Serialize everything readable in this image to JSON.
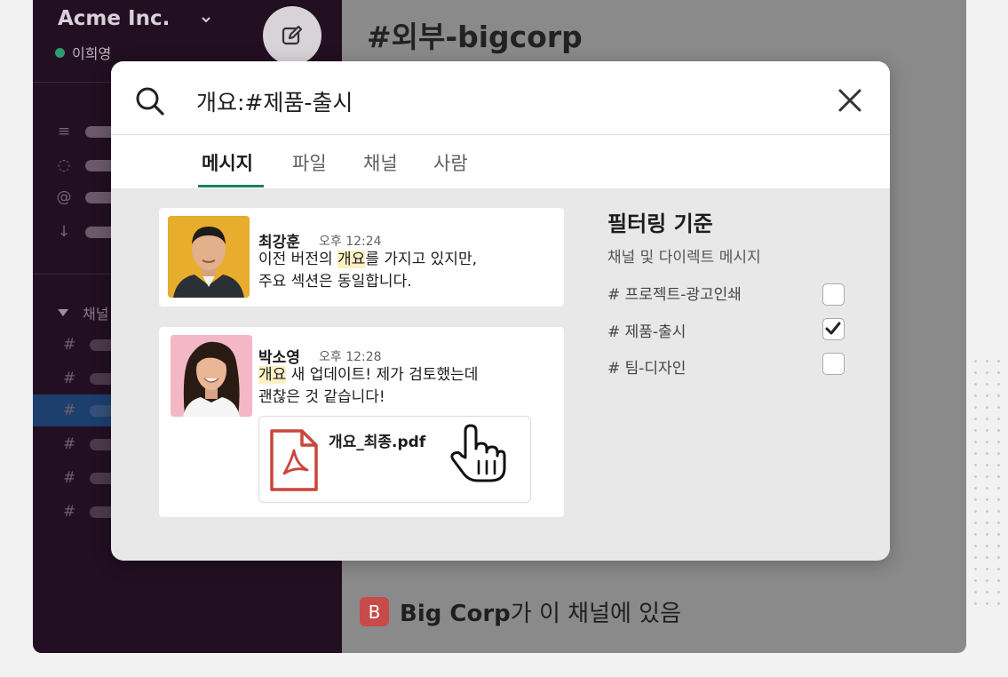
{
  "workspace": {
    "name": "Acme Inc.",
    "user": "이희영"
  },
  "sidebar": {
    "section_label": "채널"
  },
  "channel": {
    "title": "#외부-bigcorp"
  },
  "footer": {
    "badge": "B",
    "org": "Big Corp",
    "text": "가 이 채널에 있음"
  },
  "search": {
    "query": "개요:#제품-출시",
    "tabs": [
      {
        "label": "메시지",
        "active": true
      },
      {
        "label": "파일",
        "active": false
      },
      {
        "label": "채널",
        "active": false
      },
      {
        "label": "사람",
        "active": false
      }
    ]
  },
  "results": [
    {
      "author": "최강훈",
      "time": "오후 12:24",
      "line1_pre": "이전 버전의 ",
      "line1_hl": "개요",
      "line1_post": "를 가지고 있지만,",
      "line2": "주요 섹션은 동일합니다."
    },
    {
      "author": "박소영",
      "time": "오후 12:28",
      "line1_hl": "개요",
      "line1_post": " 새 업데이트! 제가 검토했는데",
      "line2": "괜찮은 것 같습니다!",
      "file_name": "개요_최종.pdf"
    }
  ],
  "filters": {
    "title": "필터링 기준",
    "subtitle": "채널 및 다이렉트 메시지",
    "items": [
      {
        "label": "# 프로젝트-광고인쇄",
        "checked": false
      },
      {
        "label": "# 제품-출시",
        "checked": true
      },
      {
        "label": "# 팀-디자인",
        "checked": false
      }
    ]
  },
  "colors": {
    "sidebar": "#220f22",
    "accent": "#1a7f64",
    "highlight": "#fdf1c4",
    "badge": "#c94a4a"
  }
}
